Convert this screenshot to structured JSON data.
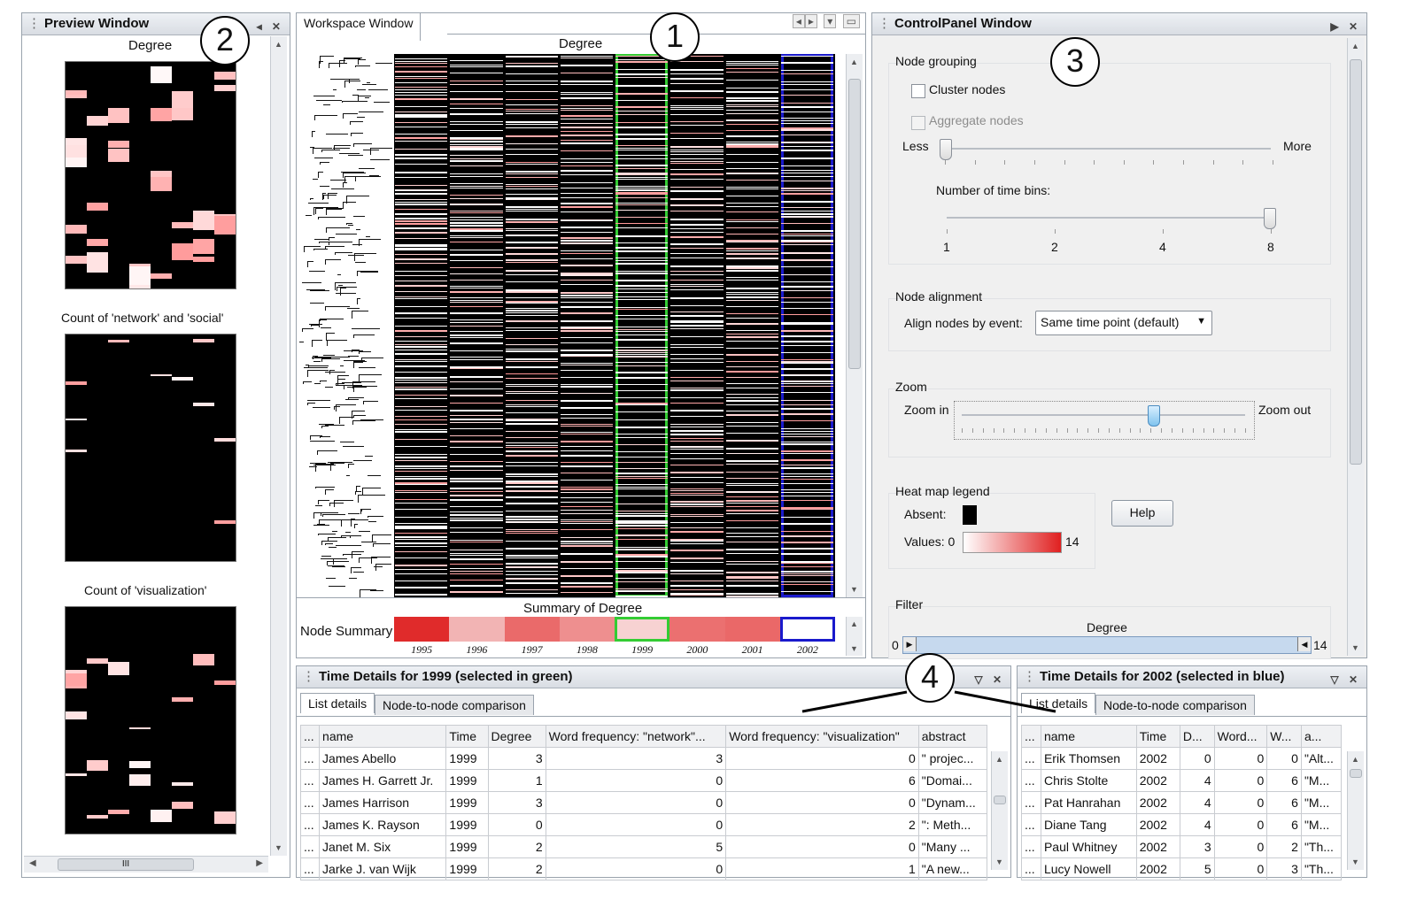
{
  "callouts": [
    "1",
    "2",
    "3",
    "4"
  ],
  "preview": {
    "title": "Preview Window",
    "icons": "◂ ✕",
    "charts": [
      {
        "label": "Degree"
      },
      {
        "label": "Count of 'network' and 'social'"
      },
      {
        "label": "Count of 'visualization'"
      }
    ],
    "hscroll_glyph": "III"
  },
  "workspace": {
    "tab": "Workspace Window",
    "header": "Degree",
    "summary_header": "Summary of Degree",
    "node_summary_label": "Node  Summary",
    "years": [
      "1995",
      "1996",
      "1997",
      "1998",
      "1999",
      "2000",
      "2001",
      "2002"
    ],
    "summary_colors": [
      "#e02b2b",
      "#f2b4b4",
      "#ea6a6a",
      "#ee8f8f",
      "#f7d2d2",
      "#eb7070",
      "#ea6868",
      "#ffffff"
    ],
    "selected_green": "1999",
    "selected_blue": "2002",
    "green_color": "#33cc33",
    "blue_color": "#1a1acc"
  },
  "control": {
    "title": "ControlPanel Window",
    "icons": "▶ ✕",
    "node_grouping": {
      "title": "Node grouping",
      "cluster": "Cluster nodes",
      "aggregate": "Aggregate nodes",
      "less": "Less",
      "more": "More",
      "bins_label": "Number of time bins:",
      "bin_ticks": [
        "1",
        "2",
        "4",
        "8"
      ]
    },
    "node_alignment": {
      "title": "Node alignment",
      "label": "Align nodes by event:",
      "value": "Same time point (default)"
    },
    "zoom": {
      "title": "Zoom",
      "in": "Zoom in",
      "out": "Zoom out"
    },
    "legend": {
      "title": "Heat map legend",
      "absent": "Absent:",
      "values": "Values: 0",
      "max": "14",
      "help": "Help"
    },
    "filter": {
      "title": "Filter",
      "label": "Degree",
      "min": "0",
      "max": "14"
    }
  },
  "details_green": {
    "title": "Time Details for 1999 (selected in green)",
    "tabs": [
      "List details",
      "Node-to-node comparison"
    ],
    "columns": [
      "...",
      "name",
      "Time",
      "Degree",
      "Word frequency: \"network\"...",
      "Word frequency: \"visualization\"",
      "abstract"
    ],
    "rows": [
      [
        "...",
        "James Abello",
        "1999",
        "3",
        "3",
        "0",
        "\" projec..."
      ],
      [
        "...",
        "James H. Garrett Jr.",
        "1999",
        "1",
        "0",
        "6",
        "\"Domai..."
      ],
      [
        "...",
        "James Harrison",
        "1999",
        "3",
        "0",
        "0",
        "\"Dynam..."
      ],
      [
        "...",
        "James K. Rayson",
        "1999",
        "0",
        "0",
        "2",
        "\": Meth..."
      ],
      [
        "...",
        "Janet M. Six",
        "1999",
        "2",
        "5",
        "0",
        "\"Many ..."
      ],
      [
        "...",
        "Jarke J. van Wijk",
        "1999",
        "2",
        "0",
        "1",
        "\"A new..."
      ]
    ]
  },
  "details_blue": {
    "title": "Time Details for 2002 (selected in blue)",
    "tabs": [
      "List details",
      "Node-to-node comparison"
    ],
    "columns": [
      "...",
      "name",
      "Time",
      "D...",
      "Word...",
      "W...",
      "a..."
    ],
    "rows": [
      [
        "...",
        "Erik Thomsen",
        "2002",
        "0",
        "0",
        "0",
        "\"Alt..."
      ],
      [
        "...",
        "Chris Stolte",
        "2002",
        "4",
        "0",
        "6",
        "\"M..."
      ],
      [
        "...",
        "Pat Hanrahan",
        "2002",
        "4",
        "0",
        "6",
        "\"M..."
      ],
      [
        "...",
        "Diane Tang",
        "2002",
        "4",
        "0",
        "6",
        "\"M..."
      ],
      [
        "...",
        "Paul Whitney",
        "2002",
        "3",
        "0",
        "2",
        "\"Th..."
      ],
      [
        "...",
        "Lucy Nowell",
        "2002",
        "5",
        "0",
        "3",
        "\"Th..."
      ]
    ]
  }
}
